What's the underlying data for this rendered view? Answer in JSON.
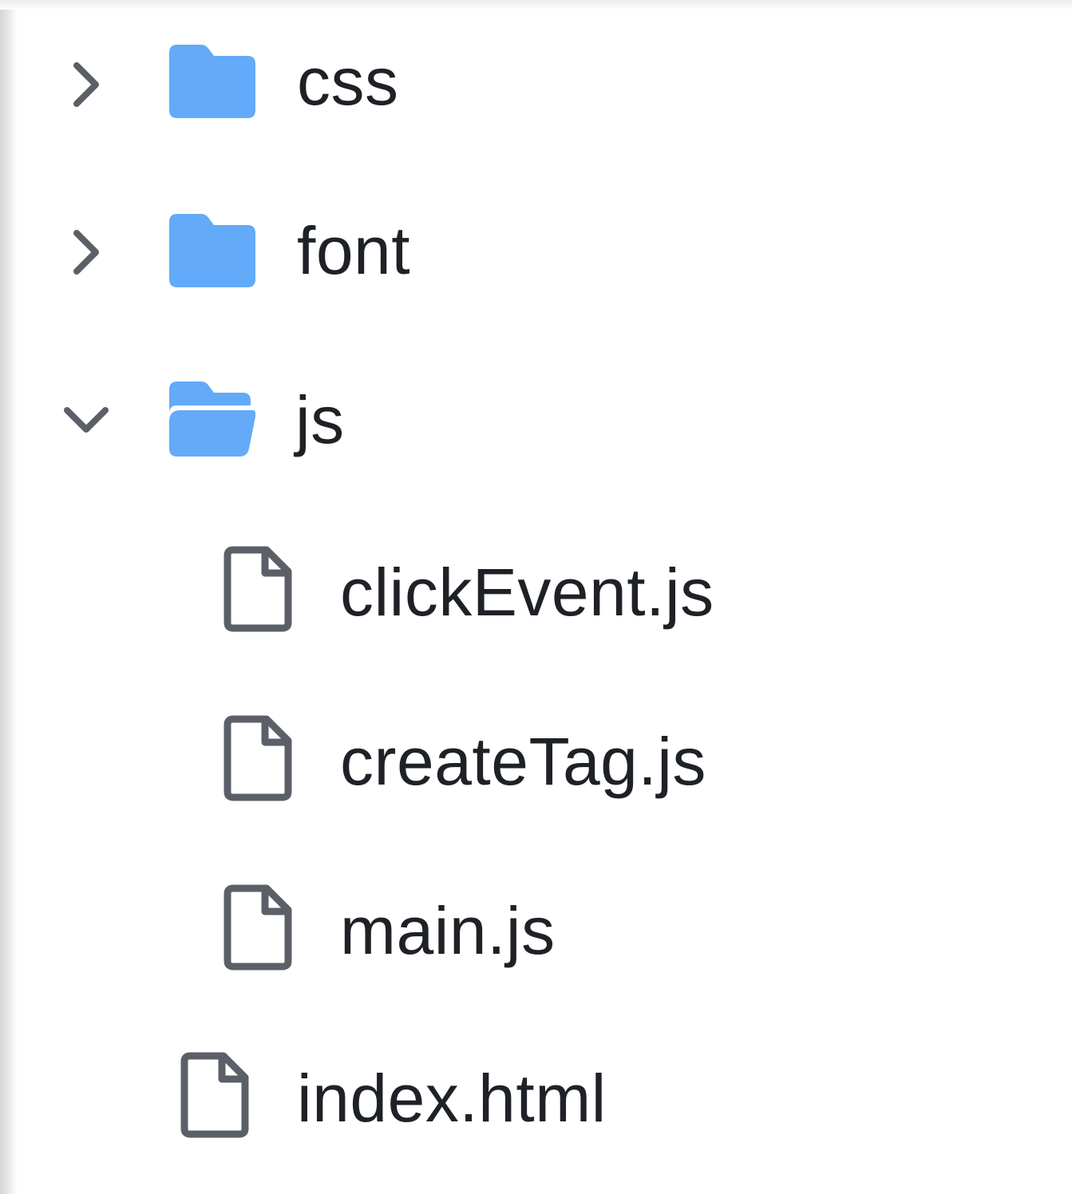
{
  "colors": {
    "folder": "#63aaf8",
    "chevron": "#5b6068",
    "file_icon": "#5b6068",
    "text": "#1e2227"
  },
  "tree": {
    "items": [
      {
        "label": "css",
        "type": "folder",
        "expanded": false,
        "icon": "folder-icon",
        "chevron": "chevron-right-icon"
      },
      {
        "label": "font",
        "type": "folder",
        "expanded": false,
        "icon": "folder-icon",
        "chevron": "chevron-right-icon"
      },
      {
        "label": "js",
        "type": "folder",
        "expanded": true,
        "icon": "folder-open-icon",
        "chevron": "chevron-down-icon",
        "children": [
          {
            "label": "clickEvent.js",
            "type": "file",
            "icon": "file-icon"
          },
          {
            "label": "createTag.js",
            "type": "file",
            "icon": "file-icon"
          },
          {
            "label": "main.js",
            "type": "file",
            "icon": "file-icon"
          }
        ]
      },
      {
        "label": "index.html",
        "type": "file",
        "icon": "file-icon"
      }
    ]
  }
}
